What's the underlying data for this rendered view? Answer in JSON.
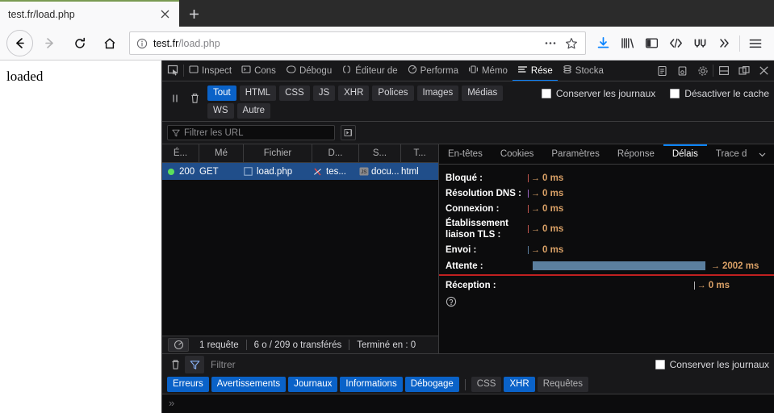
{
  "browser": {
    "tab": {
      "title": "test.fr/load.php",
      "close_icon": "close-icon",
      "new_tab_icon": "plus-icon"
    },
    "nav": {
      "back_icon": "back-arrow-icon",
      "forward_icon": "forward-arrow-icon",
      "reload_icon": "reload-icon",
      "home_icon": "home-icon"
    },
    "url": {
      "host": "test.fr",
      "path": "/load.php",
      "info_icon": "info-icon",
      "page_actions_icon": "ellipsis-icon",
      "bookmark_icon": "star-icon"
    },
    "toolbar_icons": [
      "download-icon",
      "library-icon",
      "sidebar-icon",
      "code-icon",
      "wasm-icon",
      "overflow-chevron-icon",
      "hamburger-menu-icon"
    ],
    "accent": "#0a84ff"
  },
  "page": {
    "content": "loaded"
  },
  "devtools": {
    "picker_icon": "element-picker-icon",
    "tabs": [
      {
        "label": "Inspect",
        "icon": "inspector-icon",
        "selected": false
      },
      {
        "label": "Cons",
        "icon": "console-icon",
        "selected": false
      },
      {
        "label": "Débogu",
        "icon": "debugger-icon",
        "selected": false
      },
      {
        "label": "Éditeur de",
        "icon": "style-editor-icon",
        "selected": false
      },
      {
        "label": "Performa",
        "icon": "performance-icon",
        "selected": false
      },
      {
        "label": "Mémo",
        "icon": "memory-icon",
        "selected": false
      },
      {
        "label": "Rése",
        "icon": "network-icon",
        "selected": true
      },
      {
        "label": "Stocka",
        "icon": "storage-icon",
        "selected": false
      }
    ],
    "right_icons": [
      "accessibility-icon",
      "screenshot-icon",
      "settings-gear-icon",
      "dock-bottom-icon",
      "dock-side-icon",
      "close-devtools-icon"
    ],
    "network": {
      "pause_icon": "pause-icon",
      "clear_icon": "trash-icon",
      "filters": [
        {
          "label": "Tout",
          "active": true
        },
        {
          "label": "HTML",
          "active": false
        },
        {
          "label": "CSS",
          "active": false
        },
        {
          "label": "JS",
          "active": false
        },
        {
          "label": "XHR",
          "active": false
        },
        {
          "label": "Polices",
          "active": false
        },
        {
          "label": "Images",
          "active": false
        },
        {
          "label": "Médias",
          "active": false
        },
        {
          "label": "WS",
          "active": false
        },
        {
          "label": "Autre",
          "active": false
        }
      ],
      "checkboxes": [
        {
          "label": "Conserver les journaux",
          "checked": false
        },
        {
          "label": "Désactiver le cache",
          "checked": false
        }
      ],
      "url_filter": {
        "placeholder": "Filtrer les URL",
        "value": "",
        "funnel_icon": "funnel-icon"
      },
      "fast_forward_icon": "play-in-box-icon",
      "columns": [
        "É...",
        "Mé",
        "Fichier",
        "D...",
        "S...",
        "T..."
      ],
      "rows": [
        {
          "status_dot": "green",
          "status": "200",
          "method": "GET",
          "file": "load.php",
          "file_icon": "blocked-icon",
          "domain": "tes...",
          "domain_icon": "js-badge-icon",
          "cause": "docu...",
          "type": "html",
          "selected": true
        }
      ],
      "status_bar": {
        "network_icon": "network-throttle-icon",
        "requests": "1 requête",
        "transferred": "6 o / 209 o transférés",
        "finished": "Terminé en : 0"
      }
    },
    "detail": {
      "tabs": [
        {
          "label": "En-têtes",
          "selected": false
        },
        {
          "label": "Cookies",
          "selected": false
        },
        {
          "label": "Paramètres",
          "selected": false
        },
        {
          "label": "Réponse",
          "selected": false
        },
        {
          "label": "Délais",
          "selected": true
        },
        {
          "label": "Trace d",
          "selected": false
        }
      ],
      "caret_icon": "chevron-down-icon",
      "help_icon": "help-circle-icon",
      "timings": [
        {
          "label": "Bloqué :",
          "value": "0 ms",
          "tick": "#c0554d",
          "bar": false
        },
        {
          "label": "Résolution DNS :",
          "value": "0 ms",
          "tick": "#9a63c0",
          "bar": false
        },
        {
          "label": "Connexion :",
          "value": "0 ms",
          "tick": "#c0554d",
          "bar": false
        },
        {
          "label": "Établissement liaison TLS :",
          "value": "0 ms",
          "tick": "#c0554d",
          "bar": false
        },
        {
          "label": "Envoi :",
          "value": "0 ms",
          "tick": "#5b7f9e",
          "bar": false
        },
        {
          "label": "Attente :",
          "value": "2002 ms",
          "tick": "#5b7f9e",
          "bar": true
        },
        {
          "label": "Réception :",
          "value": "0 ms",
          "tick": "#b1b1b3",
          "bar": false,
          "right_aligned": true
        }
      ],
      "bar_color": "#5b7f9e",
      "marker_color": "#c02020"
    },
    "console": {
      "clear_icon": "trash-icon",
      "filter_icon": "funnel-icon",
      "filter_placeholder": "Filtrer",
      "keep_logs": {
        "label": "Conserver les journaux",
        "checked": false
      },
      "chips": [
        {
          "label": "Erreurs",
          "active": true
        },
        {
          "label": "Avertissements",
          "active": true
        },
        {
          "label": "Journaux",
          "active": true
        },
        {
          "label": "Informations",
          "active": true
        },
        {
          "label": "Débogage",
          "active": true
        },
        {
          "label": "CSS",
          "active": false
        },
        {
          "label": "XHR",
          "active": true
        },
        {
          "label": "Requêtes",
          "active": false
        }
      ],
      "prompt": "»"
    }
  }
}
